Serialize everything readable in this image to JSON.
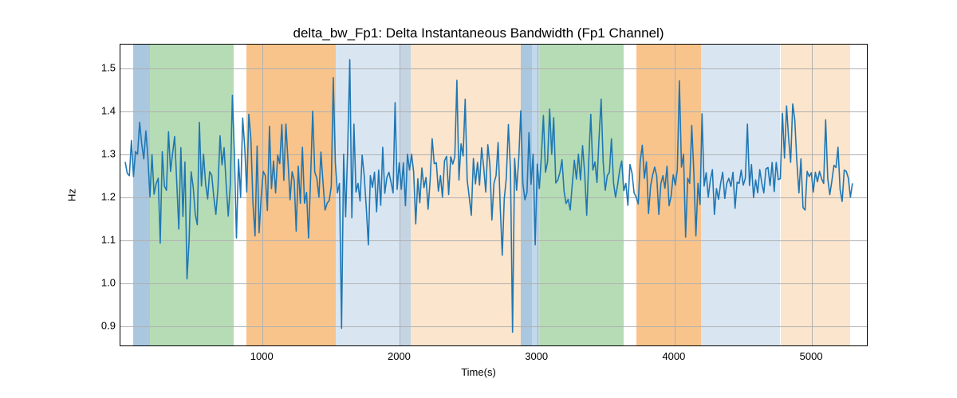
{
  "chart_data": {
    "type": "line",
    "title": "delta_bw_Fp1: Delta Instantaneous Bandwidth (Fp1 Channel)",
    "xlabel": "Time(s)",
    "ylabel": "Hz",
    "xlim": [
      -35,
      5400
    ],
    "ylim": [
      0.855,
      1.555
    ],
    "xticks": [
      1000,
      2000,
      3000,
      4000,
      5000
    ],
    "yticks": [
      0.9,
      1.0,
      1.1,
      1.2,
      1.3,
      1.4,
      1.5
    ],
    "bands": [
      {
        "x0": 60,
        "x1": 180,
        "color": "#a9c7df",
        "opacity": 1.0
      },
      {
        "x0": 180,
        "x1": 790,
        "color": "#b6dcb6",
        "opacity": 1.0
      },
      {
        "x0": 880,
        "x1": 1530,
        "color": "#f8c48b",
        "opacity": 1.0
      },
      {
        "x0": 1530,
        "x1": 2000,
        "color": "#d9e6f2",
        "opacity": 1.0
      },
      {
        "x0": 2000,
        "x1": 2080,
        "color": "#c5d4e3",
        "opacity": 1.0
      },
      {
        "x0": 2080,
        "x1": 2880,
        "color": "#fbe5cc",
        "opacity": 1.0
      },
      {
        "x0": 2880,
        "x1": 2960,
        "color": "#a9c7df",
        "opacity": 1.0
      },
      {
        "x0": 2960,
        "x1": 3020,
        "color": "#c1d9eb",
        "opacity": 1.0
      },
      {
        "x0": 3020,
        "x1": 3630,
        "color": "#b6dcb6",
        "opacity": 1.0
      },
      {
        "x0": 3720,
        "x1": 4190,
        "color": "#f8c48b",
        "opacity": 1.0
      },
      {
        "x0": 4190,
        "x1": 4770,
        "color": "#d9e6f2",
        "opacity": 1.0
      },
      {
        "x0": 4770,
        "x1": 5280,
        "color": "#fbe5cc",
        "opacity": 1.0
      }
    ],
    "series": [
      {
        "name": "delta_bw_Fp1",
        "color": "#1f77b4",
        "x_step": 15,
        "x_start": 0,
        "values": [
          1.282,
          1.255,
          1.25,
          1.332,
          1.248,
          1.306,
          1.3,
          1.374,
          1.324,
          1.289,
          1.354,
          1.294,
          1.201,
          1.299,
          1.207,
          1.231,
          1.244,
          1.093,
          1.306,
          1.226,
          1.216,
          1.352,
          1.26,
          1.302,
          1.341,
          1.236,
          1.126,
          1.315,
          1.155,
          1.282,
          1.01,
          1.098,
          1.259,
          1.223,
          1.159,
          1.136,
          1.374,
          1.226,
          1.3,
          1.231,
          1.196,
          1.259,
          1.251,
          1.2,
          1.16,
          1.221,
          1.343,
          1.275,
          1.315,
          1.23,
          1.156,
          1.23,
          1.437,
          1.3,
          1.105,
          1.288,
          1.2,
          1.384,
          1.316,
          1.212,
          1.393,
          1.336,
          1.186,
          1.11,
          1.319,
          1.117,
          1.2,
          1.26,
          1.25,
          1.169,
          1.365,
          1.22,
          1.284,
          1.21,
          1.298,
          1.278,
          1.369,
          1.239,
          1.37,
          1.285,
          1.194,
          1.259,
          1.239,
          1.121,
          1.272,
          1.186,
          1.316,
          1.186,
          1.211,
          1.105,
          1.246,
          1.4,
          1.258,
          1.244,
          1.2,
          1.305,
          1.235,
          1.17,
          1.186,
          1.192,
          1.226,
          1.478,
          1.28,
          1.21,
          1.232,
          0.895,
          1.3,
          1.154,
          1.314,
          1.52,
          1.152,
          1.37,
          1.212,
          1.232,
          1.191,
          1.298,
          1.25,
          1.175,
          1.089,
          1.25,
          1.223,
          1.258,
          1.166,
          1.263,
          1.181,
          1.316,
          1.209,
          1.246,
          1.258,
          1.235,
          1.21,
          1.42,
          1.218,
          1.28,
          1.218,
          1.28,
          1.18,
          1.3,
          1.263,
          1.3,
          1.258,
          1.138,
          1.243,
          1.187,
          1.268,
          1.222,
          1.246,
          1.172,
          1.238,
          1.336,
          1.278,
          1.28,
          1.214,
          1.25,
          1.2,
          1.285,
          1.295,
          1.206,
          1.294,
          1.277,
          1.294,
          1.472,
          1.24,
          1.324,
          1.296,
          1.428,
          1.24,
          1.2,
          1.158,
          1.29,
          1.231,
          1.281,
          1.228,
          1.315,
          1.27,
          1.212,
          1.322,
          1.274,
          1.147,
          1.232,
          1.25,
          1.327,
          1.18,
          1.065,
          1.196,
          1.245,
          1.369,
          1.263,
          0.886,
          1.29,
          1.216,
          1.287,
          1.401,
          1.232,
          1.194,
          1.211,
          1.35,
          1.23,
          1.3,
          1.089,
          1.277,
          1.22,
          1.294,
          1.39,
          1.258,
          1.282,
          1.405,
          1.3,
          1.385,
          1.233,
          1.24,
          1.258,
          1.287,
          1.214,
          1.185,
          1.195,
          1.17,
          1.23,
          1.286,
          1.242,
          1.3,
          1.24,
          1.32,
          1.257,
          1.158,
          1.287,
          1.393,
          1.263,
          1.282,
          1.234,
          1.34,
          1.428,
          1.283,
          1.216,
          1.25,
          1.258,
          1.336,
          1.234,
          1.2,
          1.228,
          1.263,
          1.284,
          1.215,
          1.232,
          1.181,
          1.276,
          1.256,
          1.21,
          1.2,
          1.184,
          1.284,
          1.321,
          1.244,
          1.282,
          1.162,
          1.226,
          1.251,
          1.27,
          1.249,
          1.16,
          1.232,
          1.25,
          1.221,
          1.272,
          1.18,
          1.204,
          1.252,
          1.228,
          1.264,
          1.471,
          1.27,
          1.3,
          1.107,
          1.244,
          1.232,
          1.367,
          1.258,
          1.11,
          1.232,
          1.183,
          1.394,
          1.226,
          1.257,
          1.2,
          1.24,
          1.264,
          1.16,
          1.22,
          1.195,
          1.232,
          1.258,
          1.197,
          1.232,
          1.244,
          1.225,
          1.258,
          1.174,
          1.235,
          1.232,
          1.263,
          1.228,
          1.244,
          1.37,
          1.227,
          1.276,
          1.199,
          1.24,
          1.21,
          1.264,
          1.232,
          1.21,
          1.266,
          1.269,
          1.227,
          1.281,
          1.213,
          1.281,
          1.241,
          1.243,
          1.395,
          1.291,
          1.412,
          1.338,
          1.281,
          1.417,
          1.38,
          1.282,
          1.21,
          1.289,
          1.176,
          1.17,
          1.26,
          1.248,
          1.257,
          1.212,
          1.258,
          1.236,
          1.26,
          1.243,
          1.232,
          1.38,
          1.244,
          1.206,
          1.238,
          1.274,
          1.269,
          1.316,
          1.218,
          1.19,
          1.263,
          1.26,
          1.244,
          1.2,
          1.232
        ]
      }
    ]
  }
}
